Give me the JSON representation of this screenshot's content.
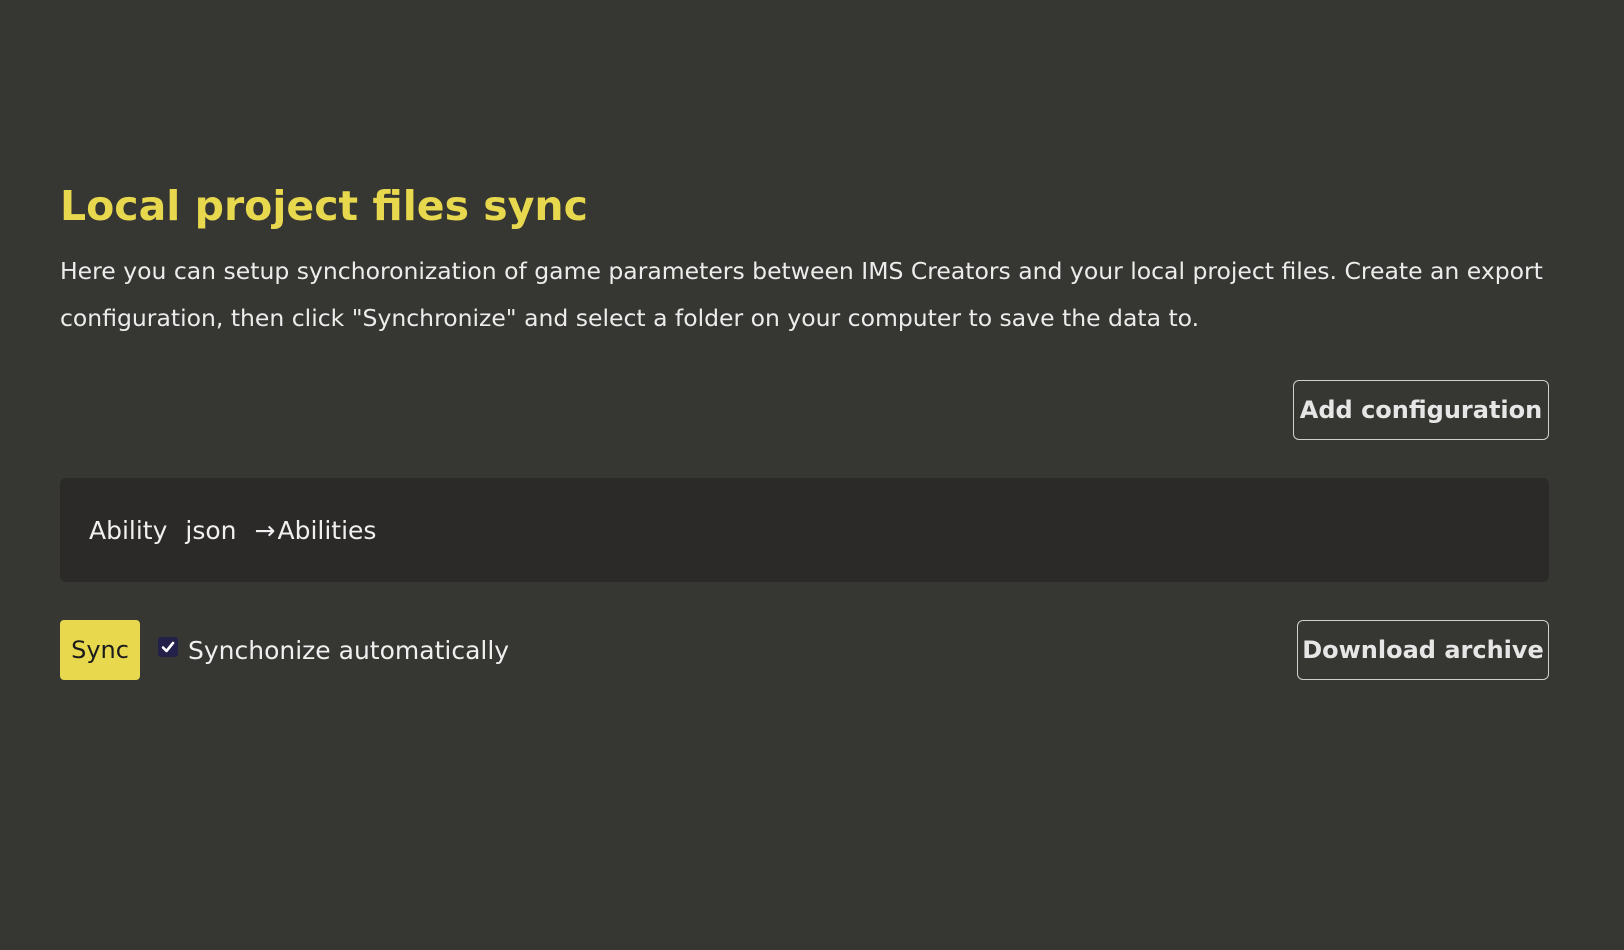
{
  "page": {
    "title": "Local project files sync",
    "description": "Here you can setup synchoronization of game parameters between IMS Creators and your local project files. Create an export configuration, then click \"Synchronize\" and select a folder on your computer to save the data to."
  },
  "actions": {
    "add_configuration_label": "Add configuration"
  },
  "configurations": [
    {
      "entity": "Ability",
      "format": "json",
      "arrow": "→",
      "target": "Abilities"
    }
  ],
  "sync": {
    "button_label": "Sync",
    "auto_sync_label": "Synchonize automatically",
    "auto_sync_checked": true,
    "download_label": "Download archive"
  },
  "icons": {
    "checkbox": "check-icon"
  },
  "colors": {
    "background": "#363632",
    "accent": "#e8d84e",
    "card_background": "#2b2a29",
    "checkbox_fill": "#23204a"
  }
}
